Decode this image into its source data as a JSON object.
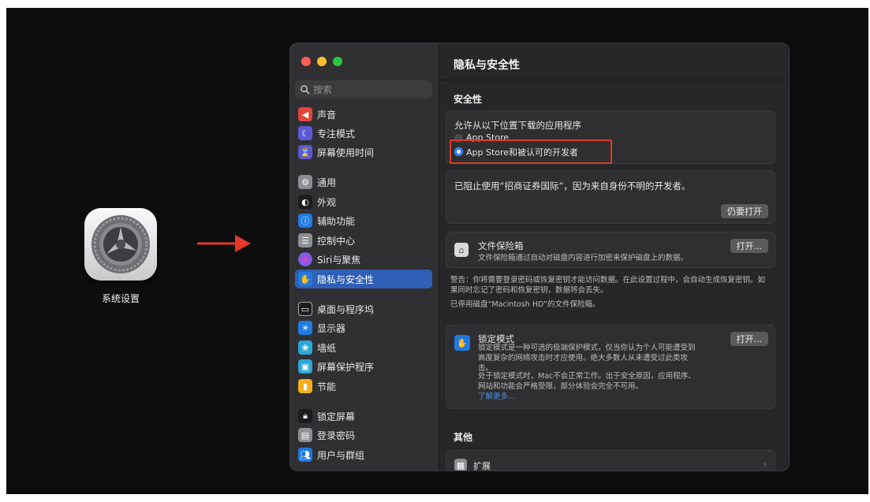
{
  "desktop": {
    "app_label": "系统设置"
  },
  "window": {
    "title": "隐私与安全性",
    "search_placeholder": "搜索",
    "sidebar": {
      "items": [
        {
          "label": "声音",
          "icon": "speaker-icon",
          "color": "#e2453c"
        },
        {
          "label": "专注模式",
          "icon": "moon-icon",
          "color": "#5a5ad6"
        },
        {
          "label": "屏幕使用时间",
          "icon": "hourglass-icon",
          "color": "#5a5ad6"
        },
        {
          "label": "通用",
          "icon": "gear-icon",
          "color": "#8e8e93"
        },
        {
          "label": "外观",
          "icon": "appearance-icon",
          "color": "#1c1c1e"
        },
        {
          "label": "辅助功能",
          "icon": "accessibility-icon",
          "color": "#1f7ae0"
        },
        {
          "label": "控制中心",
          "icon": "control-center-icon",
          "color": "#8e8e93"
        },
        {
          "label": "Siri与聚焦",
          "icon": "siri-icon",
          "color": "#7a4be0"
        },
        {
          "label": "隐私与安全性",
          "icon": "hand-icon",
          "color": "#1f7ae0"
        },
        {
          "label": "桌面与程序坞",
          "icon": "dock-icon",
          "color": "#1c1c1e"
        },
        {
          "label": "显示器",
          "icon": "display-icon",
          "color": "#1f7ae0"
        },
        {
          "label": "墙纸",
          "icon": "wallpaper-icon",
          "color": "#2aa7d9"
        },
        {
          "label": "屏幕保护程序",
          "icon": "screensaver-icon",
          "color": "#2aa7d9"
        },
        {
          "label": "节能",
          "icon": "energy-icon",
          "color": "#f2b01e"
        },
        {
          "label": "锁定屏幕",
          "icon": "lock-icon",
          "color": "#1c1c1e"
        },
        {
          "label": "登录密码",
          "icon": "password-icon",
          "color": "#8e8e93"
        },
        {
          "label": "用户与群组",
          "icon": "users-icon",
          "color": "#1f7ae0"
        }
      ]
    },
    "security": {
      "section_title": "安全性",
      "allow_label": "允许从以下位置下载的应用程序",
      "option_app_store": "App Store",
      "option_identified": "App Store和被认可的开发者",
      "blocked_message": "已阻止使用“招商证券国际”，因为来自身份不明的开发者。",
      "open_anyway_button": "仍要打开"
    },
    "filevault": {
      "title": "文件保险箱",
      "description": "文件保险箱通过自动对磁盘内容进行加密来保护磁盘上的数据。",
      "button": "打开...",
      "warning": "警告：你将需要登录密码或恢复密钥才能访问数据。在此设置过程中，会自动生成恢复密钥。如果同时忘记了密码和恢复密钥，数据将会丢失。",
      "status": "已停用磁盘“Macintosh HD”的文件保险箱。"
    },
    "lockdown": {
      "title": "锁定模式",
      "button": "打开...",
      "description": "锁定模式是一种可选的极端保护模式，仅当你认为个人可能遭受到高度复杂的网络攻击时才应使用。绝大多数人从未遭受过此类攻击。",
      "details": "处于锁定模式时，Mac不会正常工作。出于安全原因，应用程序、网站和功能会严格受限，部分体验会完全不可用。",
      "learn_more": "了解更多..."
    },
    "other": {
      "section_title": "其他",
      "extensions_label": "扩展"
    }
  }
}
